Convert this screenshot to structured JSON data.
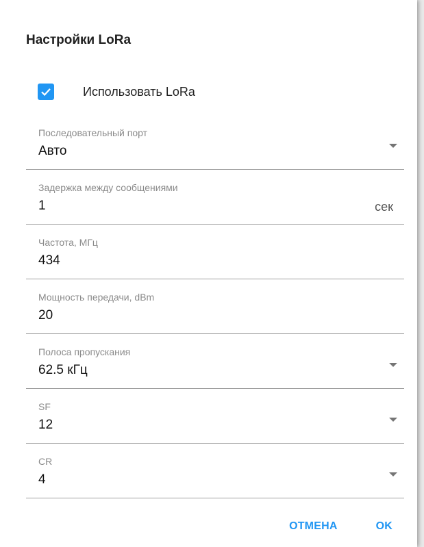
{
  "dialog": {
    "title": "Настройки LoRa"
  },
  "use_lora": {
    "label": "Использовать LoRa",
    "checked": true
  },
  "fields": {
    "serial_port": {
      "label": "Последовательный порт",
      "value": "Авто"
    },
    "delay": {
      "label": "Задержка между сообщениями",
      "value": "1",
      "suffix": "сек"
    },
    "frequency": {
      "label": "Частота, МГц",
      "value": "434"
    },
    "power": {
      "label": "Мощность передачи, dBm",
      "value": "20"
    },
    "bandwidth": {
      "label": "Полоса пропускания",
      "value": "62.5 кГц"
    },
    "sf": {
      "label": "SF",
      "value": "12"
    },
    "cr": {
      "label": "CR",
      "value": "4"
    }
  },
  "actions": {
    "cancel_label": "ОТМЕНА",
    "ok_label": "OK"
  },
  "colors": {
    "accent": "#2196f3"
  }
}
